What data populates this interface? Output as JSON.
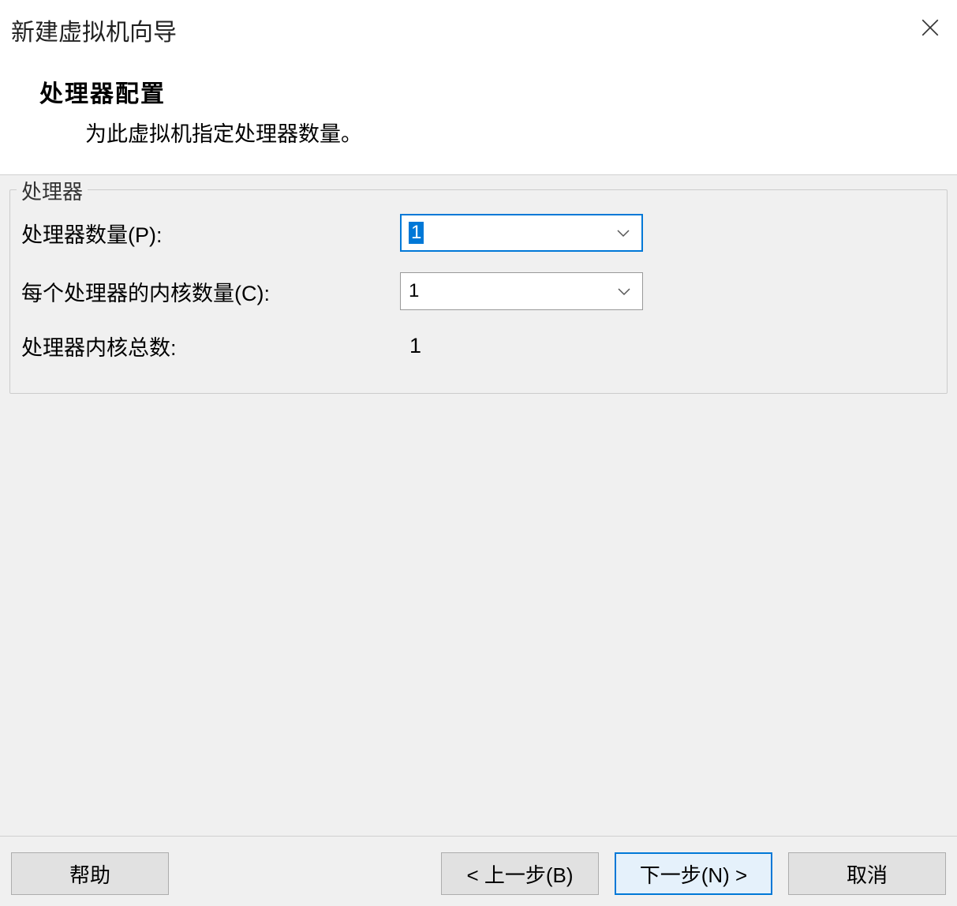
{
  "titlebar": {
    "title": "新建虚拟机向导"
  },
  "header": {
    "title": "处理器配置",
    "description": "为此虚拟机指定处理器数量。"
  },
  "groupbox": {
    "legend": "处理器",
    "fields": {
      "processor_count": {
        "label": "处理器数量(P):",
        "value": "1"
      },
      "cores_per_processor": {
        "label": "每个处理器的内核数量(C):",
        "value": "1"
      },
      "total_cores": {
        "label": "处理器内核总数:",
        "value": "1"
      }
    }
  },
  "footer": {
    "help": "帮助",
    "back": "< 上一步(B)",
    "next": "下一步(N) >",
    "cancel": "取消"
  }
}
